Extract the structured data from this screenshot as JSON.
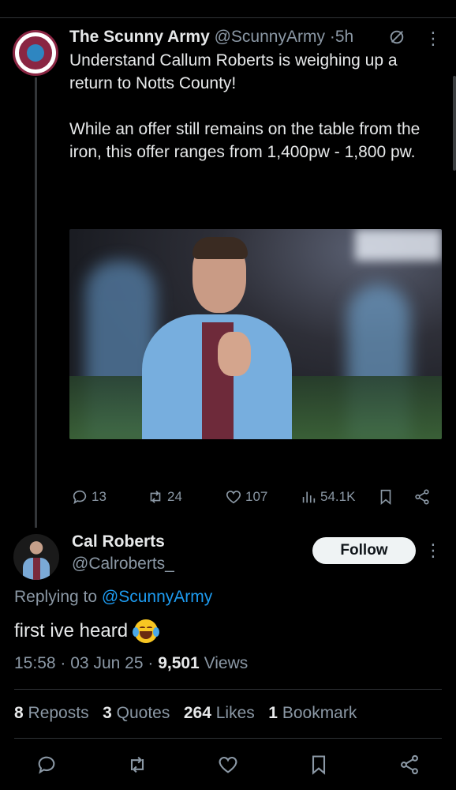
{
  "parent": {
    "name": "The Scunny Army",
    "handle": "@ScunnyArmy",
    "time": "5h",
    "text": "Understand Callum Roberts is weighing up a return to Notts County!\n\nWhile an offer still remains on the table from the iron, this offer ranges from 1,400pw - 1,800 pw.",
    "avatar_ring_text": "THE SCUNNY ARMY · UP THE IRON",
    "actions": {
      "replies": "13",
      "reposts": "24",
      "likes": "107",
      "views": "54.1K"
    }
  },
  "reply": {
    "name": "Cal Roberts",
    "handle": "@Calroberts_",
    "follow_label": "Follow",
    "replying_prefix": "Replying to",
    "replying_to": "@ScunnyArmy",
    "text": "first ive heard",
    "emoji": "laughing-tears-emoji",
    "time": "15:58",
    "date": "03 Jun 25",
    "views_count": "9,501",
    "views_label": "Views"
  },
  "stats": {
    "reposts_count": "8",
    "reposts_label": "Reposts",
    "quotes_count": "3",
    "quotes_label": "Quotes",
    "likes_count": "264",
    "likes_label": "Likes",
    "bookmarks_count": "1",
    "bookmarks_label": "Bookmark"
  },
  "colors": {
    "background": "#000000",
    "text": "#e7e9ea",
    "muted": "#8b98a5",
    "accent": "#1d9bf0",
    "club_claret": "#8a2643"
  }
}
